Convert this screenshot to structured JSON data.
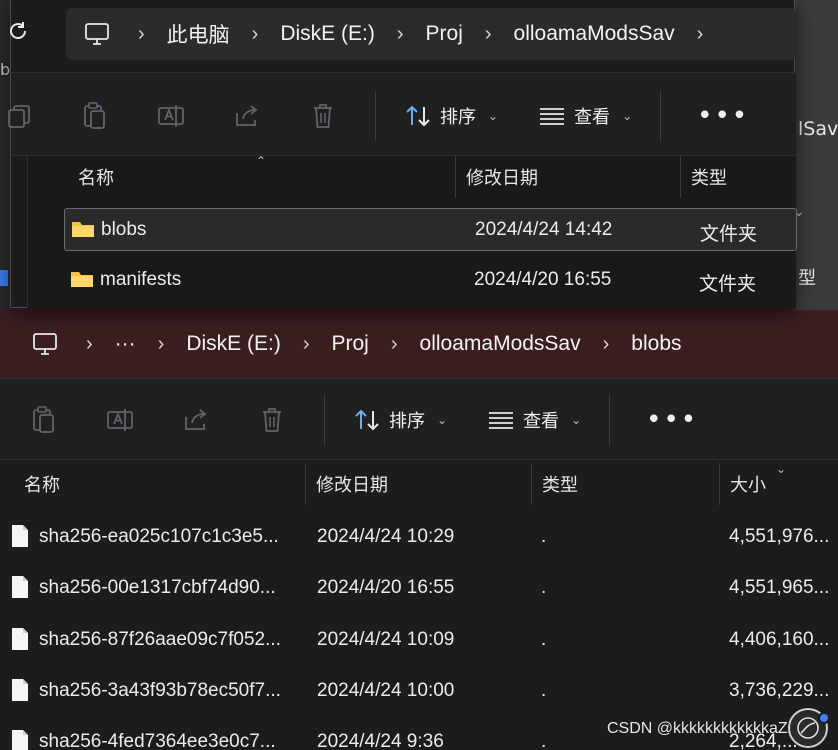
{
  "background_fragments": {
    "right_label_1": "lSav",
    "right_label_2": "型",
    "left_label": "b"
  },
  "window_top": {
    "breadcrumb": [
      "此电脑",
      "DiskE (E:)",
      "Proj",
      "olloamaModsSav"
    ],
    "toolbar": {
      "sort_label": "排序",
      "view_label": "查看",
      "more_label": "•••"
    },
    "columns": [
      "名称",
      "修改日期",
      "类型"
    ],
    "rows": [
      {
        "name": "blobs",
        "modified": "2024/4/24 14:42",
        "type": "文件夹"
      },
      {
        "name": "manifests",
        "modified": "2024/4/20 16:55",
        "type": "文件夹"
      }
    ]
  },
  "window_bottom": {
    "breadcrumb_overflow": "···",
    "breadcrumb": [
      "DiskE (E:)",
      "Proj",
      "olloamaModsSav",
      "blobs"
    ],
    "toolbar": {
      "sort_label": "排序",
      "view_label": "查看",
      "more_label": "•••"
    },
    "columns": [
      "名称",
      "修改日期",
      "类型",
      "大小"
    ],
    "rows": [
      {
        "name": "sha256-ea025c107c1c3e5...",
        "modified": "2024/4/24 10:29",
        "type": ".",
        "size": "4,551,976..."
      },
      {
        "name": "sha256-00e1317cbf74d90...",
        "modified": "2024/4/20 16:55",
        "type": ".",
        "size": "4,551,965..."
      },
      {
        "name": "sha256-87f26aae09c7f052...",
        "modified": "2024/4/24 10:09",
        "type": ".",
        "size": "4,406,160..."
      },
      {
        "name": "sha256-3a43f93b78ec50f7...",
        "modified": "2024/4/24 10:00",
        "type": ".",
        "size": "3,736,229..."
      },
      {
        "name": "sha256-4fed7364ee3e0c7...",
        "modified": "2024/4/24 9:36",
        "type": ".",
        "size": "2,264,..."
      }
    ]
  },
  "watermark": "CSDN @kkkkkkkkkkkkaZZ4",
  "colors": {
    "folder": "#f5c242",
    "accent_dot": "#3b82f6",
    "address_bar": "#3a1e20"
  }
}
